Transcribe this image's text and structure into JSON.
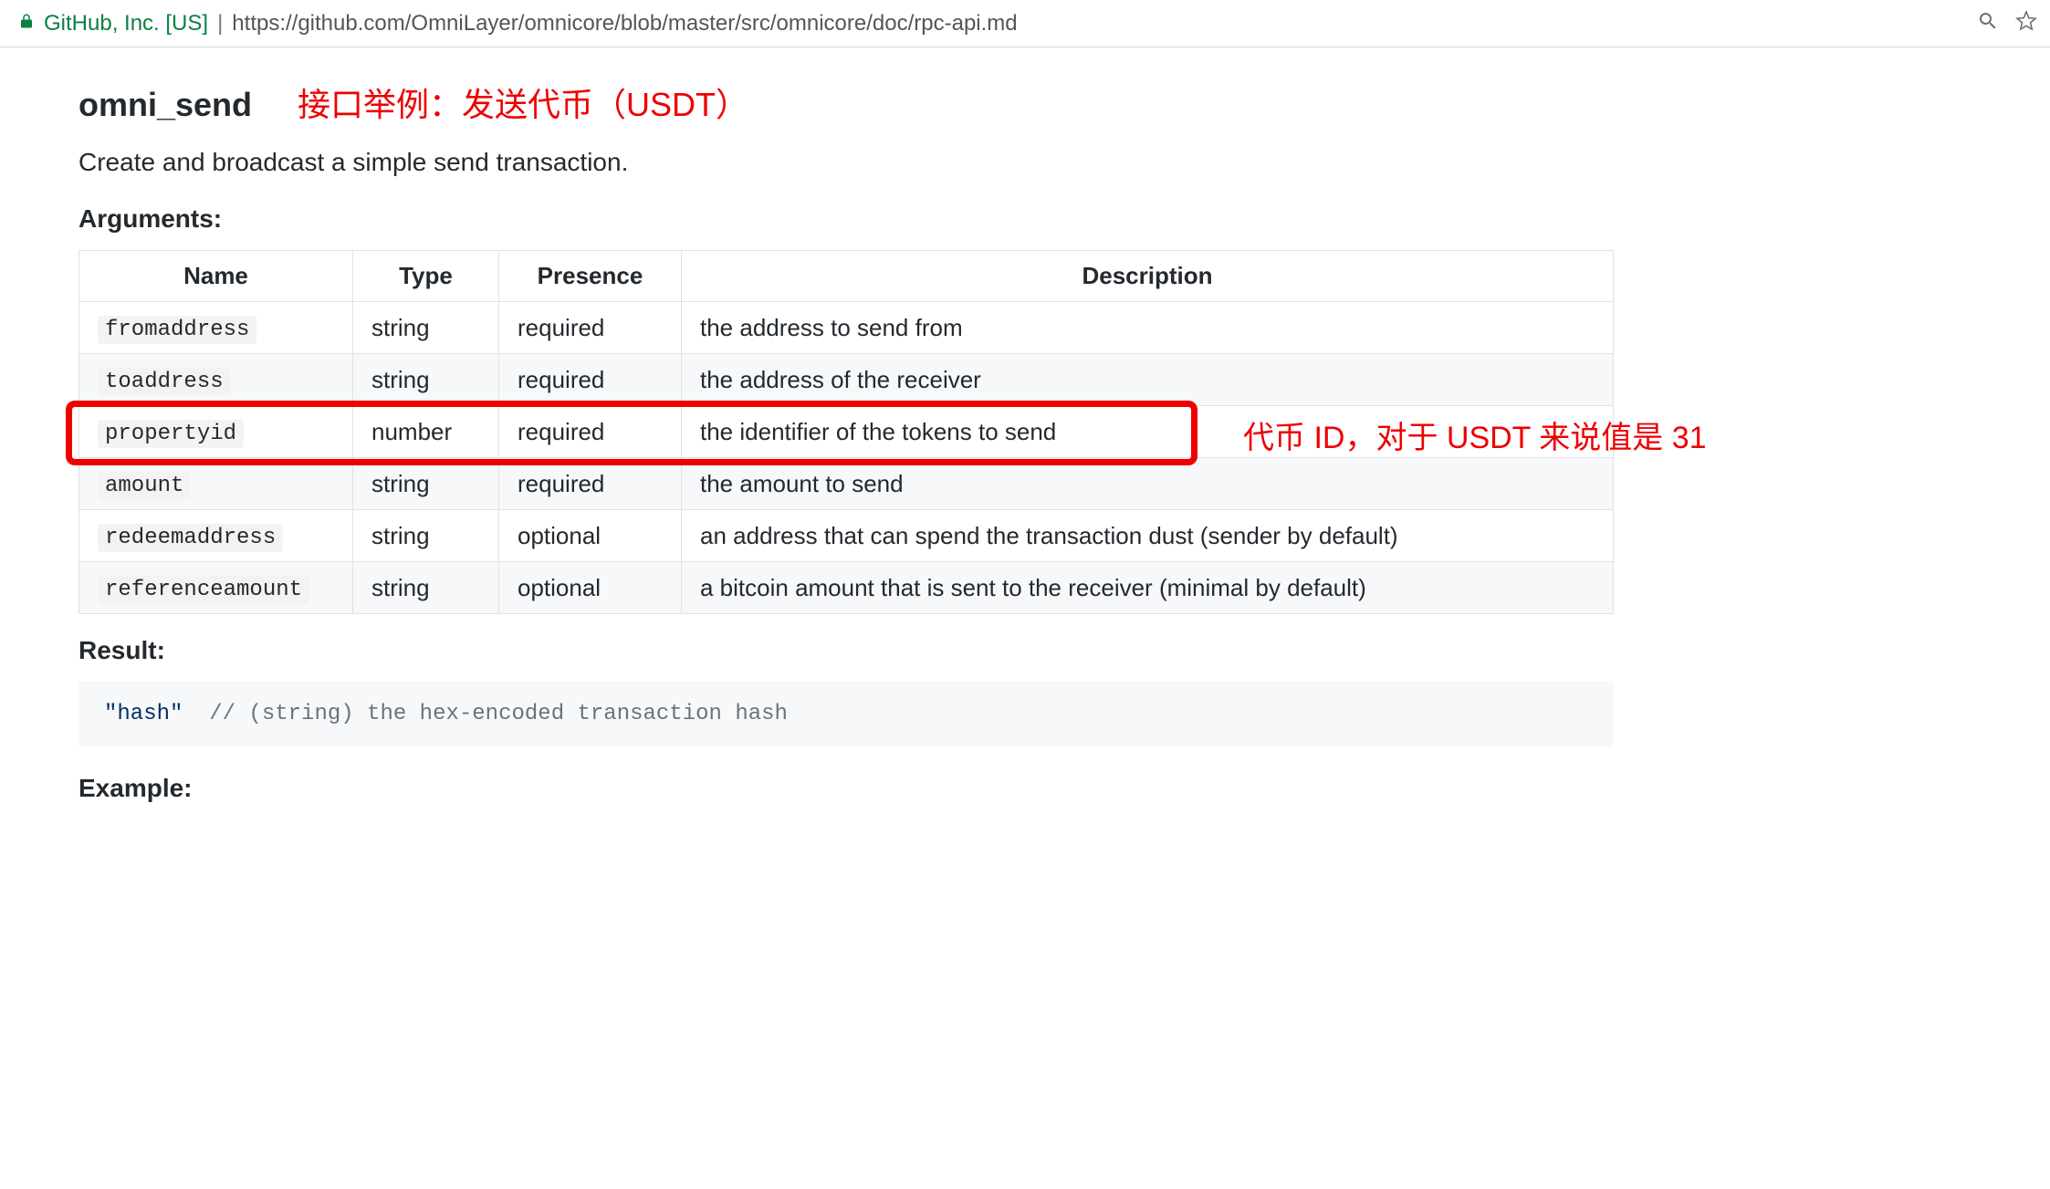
{
  "address_bar": {
    "site_label": "GitHub, Inc. [US]",
    "url": "https://github.com/OmniLayer/omnicore/blob/master/src/omnicore/doc/rpc-api.md"
  },
  "heading": "omni_send",
  "heading_annotation": "接口举例：发送代币（USDT）",
  "description": "Create and broadcast a simple send transaction.",
  "arguments_label": "Arguments:",
  "args_table": {
    "headers": {
      "name": "Name",
      "type": "Type",
      "presence": "Presence",
      "description": "Description"
    },
    "rows": [
      {
        "name": "fromaddress",
        "type": "string",
        "presence": "required",
        "description": "the address to send from"
      },
      {
        "name": "toaddress",
        "type": "string",
        "presence": "required",
        "description": "the address of the receiver"
      },
      {
        "name": "propertyid",
        "type": "number",
        "presence": "required",
        "description": "the identifier of the tokens to send"
      },
      {
        "name": "amount",
        "type": "string",
        "presence": "required",
        "description": "the amount to send"
      },
      {
        "name": "redeemaddress",
        "type": "string",
        "presence": "optional",
        "description": "an address that can spend the transaction dust (sender by default)"
      },
      {
        "name": "referenceamount",
        "type": "string",
        "presence": "optional",
        "description": "a bitcoin amount that is sent to the receiver (minimal by default)"
      }
    ]
  },
  "row_highlight": {
    "index": 2,
    "annotation": "代币 ID，对于 USDT 来说值是 31"
  },
  "result_label": "Result:",
  "result_code": {
    "string_part": "\"hash\"",
    "comment_part": "  // (string) the hex-encoded transaction hash"
  },
  "example_label": "Example:"
}
